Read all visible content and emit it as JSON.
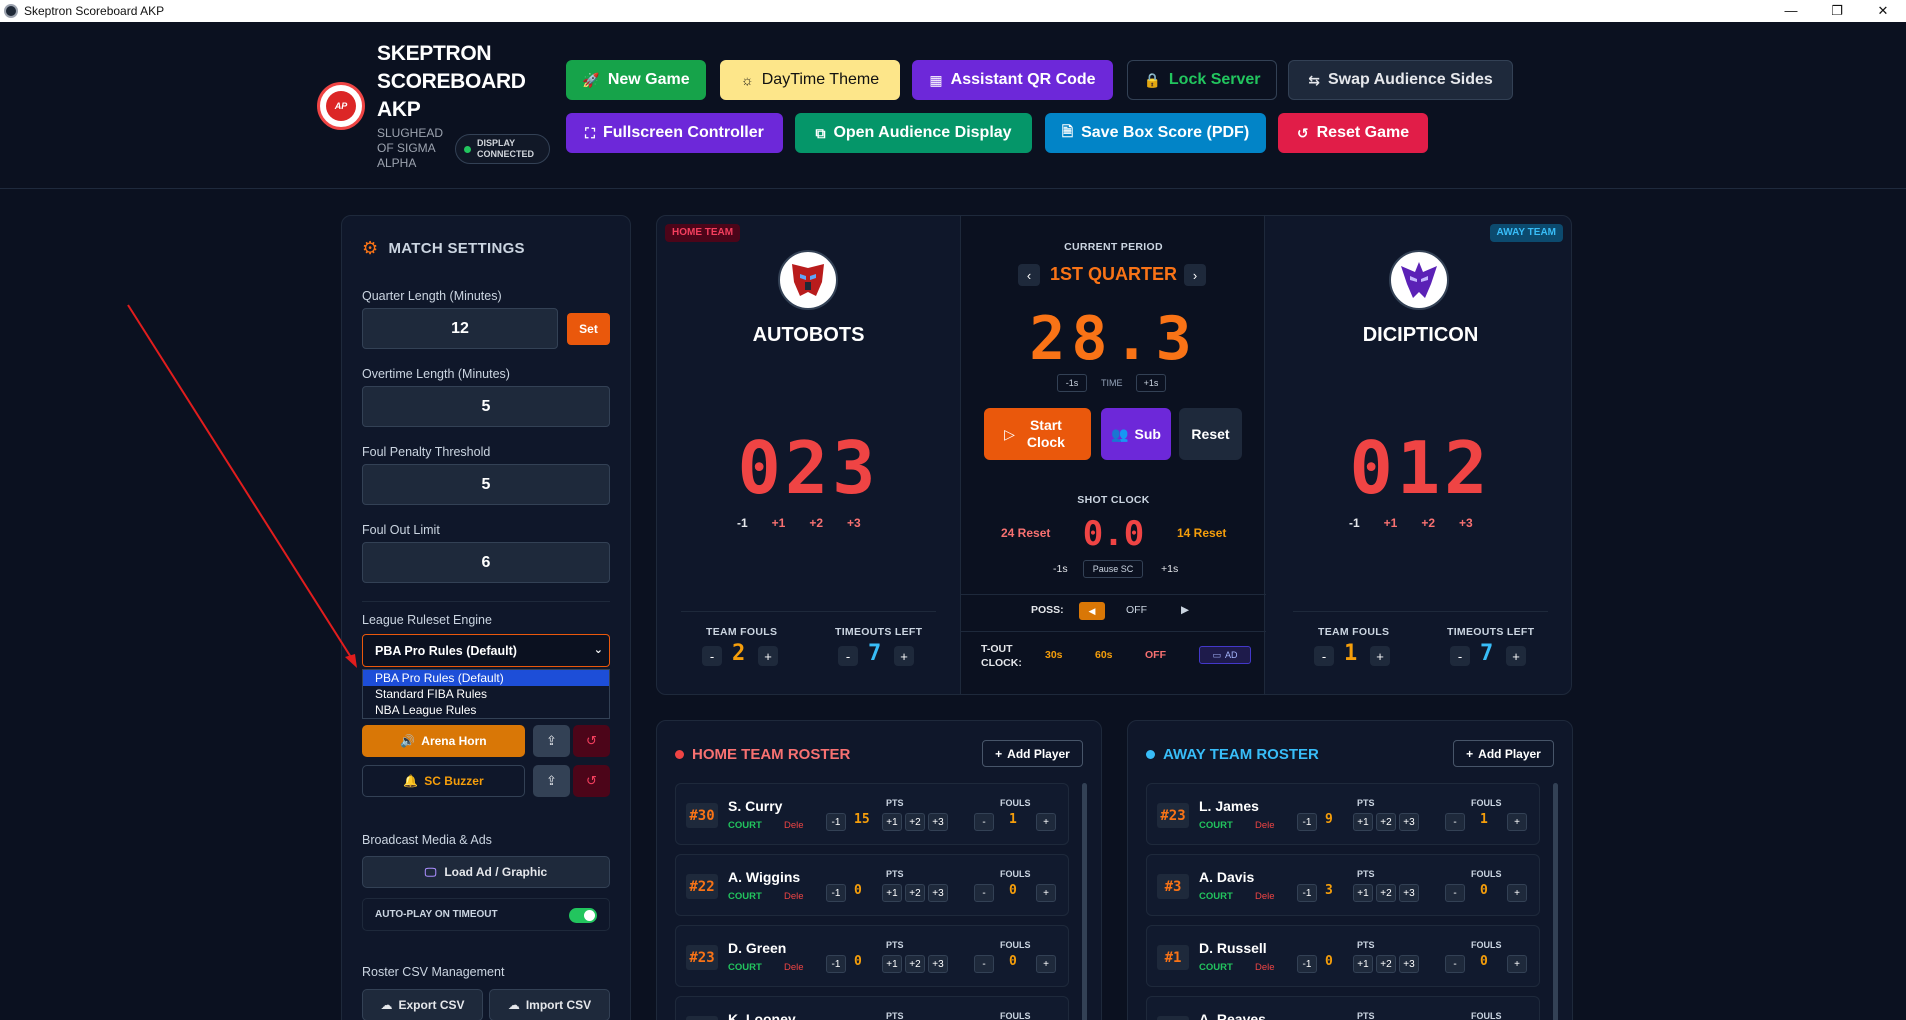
{
  "window": {
    "title": "Skeptron Scoreboard AKP",
    "minimize": "—",
    "restore": "❐",
    "close": "✕"
  },
  "brand": {
    "logo_text": "AP",
    "title": "SKEPTRON SCOREBOARD AKP",
    "subtitle": "SLUGHEAD OF SIGMA ALPHA",
    "status": "DISPLAY CONNECTED"
  },
  "toolbar": {
    "new_game": "New Game",
    "daytime": "DayTime Theme",
    "qr": "Assistant QR Code",
    "lock": "Lock Server",
    "swap": "Swap Audience Sides",
    "fullscreen": "Fullscreen Controller",
    "audience": "Open Audience Display",
    "boxscore": "Save Box Score (PDF)",
    "reset": "Reset Game"
  },
  "settings": {
    "title": "MATCH SETTINGS",
    "quarter_label": "Quarter Length (Minutes)",
    "quarter_value": "12",
    "set_label": "Set",
    "overtime_label": "Overtime Length (Minutes)",
    "overtime_value": "5",
    "foul_penalty_label": "Foul Penalty Threshold",
    "foul_penalty_value": "5",
    "foul_out_label": "Foul Out Limit",
    "foul_out_value": "6",
    "ruleset_label": "League Ruleset Engine",
    "ruleset_selected": "PBA Pro Rules (Default)",
    "ruleset_options": [
      "PBA Pro Rules (Default)",
      "Standard FIBA Rules",
      "NBA League Rules"
    ],
    "arena_horn": "Arena Horn",
    "sc_buzzer": "SC Buzzer",
    "media_label": "Broadcast Media & Ads",
    "load_ad": "Load Ad / Graphic",
    "autoplay": "AUTO-PLAY ON TIMEOUT",
    "csv_label": "Roster CSV Management",
    "export_csv": "Export CSV",
    "import_csv": "Import CSV"
  },
  "home": {
    "tag": "HOME TEAM",
    "name": "AUTOBOTS",
    "score": "023",
    "team_fouls": "2",
    "timeouts": "7"
  },
  "away": {
    "tag": "AWAY TEAM",
    "name": "DICIPTICON",
    "score": "012",
    "team_fouls": "1",
    "timeouts": "7"
  },
  "score_adjust": {
    "m1": "-1",
    "p1": "+1",
    "p2": "+2",
    "p3": "+3"
  },
  "labels": {
    "team_fouls": "TEAM FOULS",
    "timeouts_left": "TIMEOUTS LEFT",
    "minus": "-",
    "plus": "+"
  },
  "clock": {
    "period_label": "CURRENT PERIOD",
    "period": "1ST QUARTER",
    "time": "28.3",
    "minus_1s": "-1s",
    "time_label": "TIME",
    "plus_1s": "+1s",
    "start": "Start Clock",
    "sub": "Sub",
    "reset": "Reset",
    "shot_label": "SHOT CLOCK",
    "reset24": "24 Reset",
    "shot_value": "0.0",
    "reset14": "14 Reset",
    "sc_minus": "-1s",
    "pause_sc": "Pause SC",
    "sc_plus": "+1s",
    "poss_label": "POSS:",
    "poss_left": "◀",
    "poss_off": "OFF",
    "poss_right": "▶",
    "tout_label": "T-OUT CLOCK:",
    "t30": "30s",
    "t60": "60s",
    "toff": "OFF",
    "ad": "AD"
  },
  "roster_labels": {
    "pts": "PTS",
    "fouls": "FOULS",
    "court": "COURT",
    "del": "Dele",
    "add": "Add Player",
    "m1": "-1",
    "p1": "+1",
    "p2": "+2",
    "p3": "+3",
    "minus": "-",
    "plus": "+"
  },
  "home_roster": {
    "title": "HOME TEAM ROSTER",
    "players": [
      {
        "num": "#30",
        "name": "S. Curry",
        "pts": "15",
        "fouls": "1"
      },
      {
        "num": "#22",
        "name": "A. Wiggins",
        "pts": "0",
        "fouls": "0"
      },
      {
        "num": "#23",
        "name": "D. Green",
        "pts": "0",
        "fouls": "0"
      },
      {
        "num": "",
        "name": "K. Looney",
        "pts": "",
        "fouls": ""
      }
    ]
  },
  "away_roster": {
    "title": "AWAY TEAM ROSTER",
    "players": [
      {
        "num": "#23",
        "name": "L. James",
        "pts": "9",
        "fouls": "1"
      },
      {
        "num": "#3",
        "name": "A. Davis",
        "pts": "3",
        "fouls": "0"
      },
      {
        "num": "#1",
        "name": "D. Russell",
        "pts": "0",
        "fouls": "0"
      },
      {
        "num": "",
        "name": "A. Reaves",
        "pts": "",
        "fouls": ""
      }
    ]
  },
  "colors": {
    "accent": "#f97316",
    "home": "#ef4444",
    "away": "#38bdf8",
    "success": "#22c55e"
  }
}
